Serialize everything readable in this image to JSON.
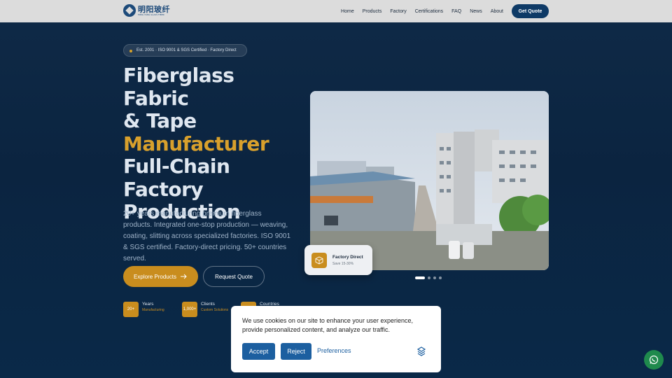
{
  "nav": {
    "logo_cn": "明阳玻纤",
    "logo_en": "MING YANG GLASS FIBER",
    "items": [
      {
        "label": "Home"
      },
      {
        "label": "Products"
      },
      {
        "label": "Factory"
      },
      {
        "label": "Certifications"
      },
      {
        "label": "FAQ"
      },
      {
        "label": "News"
      },
      {
        "label": "About"
      }
    ],
    "cta_label": "Get Quote"
  },
  "hero": {
    "badge": "Est. 2001 · ISO 9001 & SGS Certified · Factory Direct",
    "headline_line1": "Fiberglass Fabric",
    "headline_line2": "& Tape",
    "headline_accent": "Manufacturer",
    "headline_line4": "Full-Chain",
    "headline_line5": "Factory",
    "headline_line6": "Production",
    "subtext": "20+ years manufacturing premium fiberglass products. Integrated one-stop production — weaving, coating, slitting across specialized factories. ISO 9001 & SGS certified. Factory-direct pricing. 50+ countries served.",
    "primary_button": "Explore Products",
    "secondary_button": "Request Quote",
    "stats": [
      {
        "value": "20+",
        "label": "Years",
        "sub": "Manufacturing"
      },
      {
        "value": "1,000+",
        "label": "Clients",
        "sub": "Custom Solutions"
      },
      {
        "value": "",
        "label": "Countries",
        "sub": ""
      }
    ]
  },
  "carousel": {
    "floating_title": "Factory Direct",
    "floating_sub": "Save 15-30%",
    "slide_count": 4,
    "active_slide": 1
  },
  "cookie": {
    "text": "We use cookies on our site to enhance your user experience, provide personalized content, and analyze our traffic.",
    "accept": "Accept",
    "reject": "Reject",
    "preferences": "Preferences"
  },
  "colors": {
    "accent": "#c98d1e",
    "navy": "#0e3a66",
    "cookie_button": "#1c5fa0",
    "whatsapp": "#1f8a4d"
  }
}
